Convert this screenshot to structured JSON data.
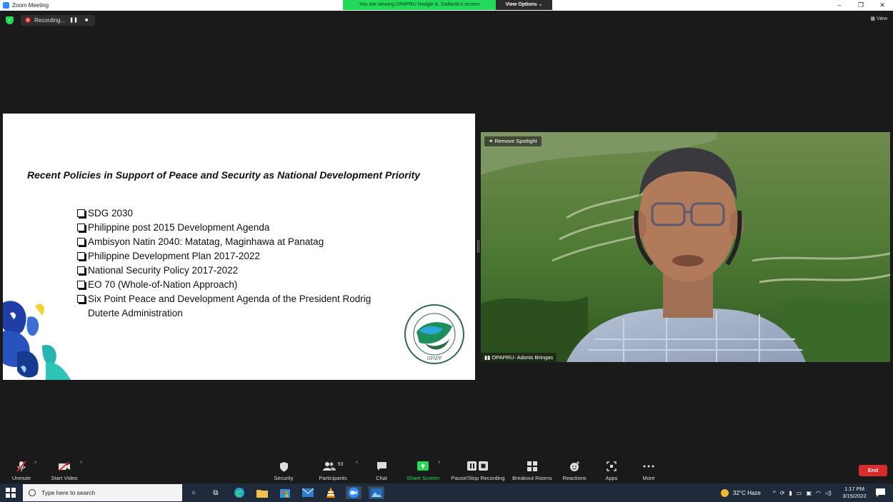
{
  "window": {
    "title": "Zoom Meeting",
    "controls": [
      "–",
      "❐",
      "✕"
    ]
  },
  "banner": {
    "viewing_text": "You are viewing OPAPRU Redgie A. Gallardo's screen",
    "view_options_label": "View Options ⌄"
  },
  "topbar": {
    "recording_label": "Recording...",
    "pause_icon": "❚❚",
    "stop_icon": "■",
    "view_label": "View"
  },
  "slide": {
    "title": "Recent Policies in Support of Peace and Security as National Development Priority",
    "items": [
      "SDG 2030",
      "Philippine post 2015 Development Agenda",
      "Ambisyon Natin 2040: Matatag, Maginhawa at Panatag",
      "Philippine Development Plan 2017-2022",
      "National Security Policy 2017-2022",
      "EO 70 (Whole-of-Nation Approach)",
      "Six Point Peace and Development Agenda of the President Rodrig"
    ],
    "item_continuation": "Duterte Administration",
    "seal_text": "OPAPP"
  },
  "video": {
    "spotlight_label": "Remove Spotlight",
    "participant_name": "OPAPRU- Adonis Bringas"
  },
  "toolbar": {
    "unmute": "Unmute",
    "start_video": "Start Video",
    "security": "Security",
    "participants": "Participants",
    "participants_count": "93",
    "chat": "Chat",
    "share_screen": "Share Screen",
    "pause_stop_recording": "Pause/Stop Recording",
    "breakout_rooms": "Breakout Rooms",
    "reactions": "Reactions",
    "apps": "Apps",
    "more": "More",
    "end": "End"
  },
  "taskbar": {
    "search_placeholder": "Type here to search",
    "weather": "32°C  Haze",
    "time": "1:17 PM",
    "date": "3/15/2022"
  },
  "colors": {
    "zoom_blue": "#2d8cff",
    "share_green": "#23d959",
    "end_red": "#d92b2b",
    "taskbar": "#1f2a3a"
  }
}
